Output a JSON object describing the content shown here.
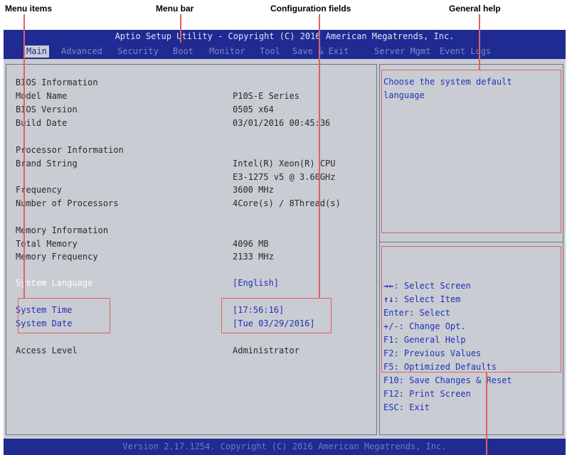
{
  "callouts": {
    "menu_items": "Menu items",
    "menu_bar": "Menu bar",
    "configuration_fields": "Configuration fields",
    "general_help": "General help"
  },
  "title": "Aptio Setup Utility - Copyright (C) 2016 American Megatrends, Inc.",
  "menu": {
    "items": [
      "Main",
      "Advanced",
      "Security",
      "Boot",
      "Monitor",
      "Tool",
      "Save & Exit",
      "Server Mgmt",
      "Event Logs"
    ],
    "active": "Main"
  },
  "info": {
    "bios_info": "BIOS Information",
    "model_name_label": "Model Name",
    "model_name_value": "P10S-E Series",
    "bios_version_label": "BIOS Version",
    "bios_version_value": "0505 x64",
    "build_date_label": "Build Date",
    "build_date_value": "03/01/2016 00:45:36",
    "processor_info": "Processor Information",
    "brand_string_label": "Brand String",
    "brand_string_value_1": "Intel(R) Xeon(R) CPU",
    "brand_string_value_2": "E3-1275 v5 @ 3.60GHz",
    "frequency_label": "Frequency",
    "frequency_value": "3600 MHz",
    "num_processors_label": "Number of Processors",
    "num_processors_value": "4Core(s) / 8Thread(s)",
    "memory_info": "Memory Information",
    "total_memory_label": "Total Memory",
    "total_memory_value": "4096 MB",
    "memory_freq_label": "Memory Frequency",
    "memory_freq_value": "2133 MHz"
  },
  "settings": {
    "system_language_label": "System Language",
    "system_language_value": "[English]",
    "system_time_label": "System Time",
    "system_time_value": "[17:56:16]",
    "system_date_label": "System Date",
    "system_date_value": "[Tue 03/29/2016]",
    "access_level_label": "Access Level",
    "access_level_value": "Administrator"
  },
  "help": {
    "description_1": "Choose the system default",
    "description_2": "language",
    "keys": [
      {
        "key": "→←",
        "text": ": Select Screen"
      },
      {
        "key": "↑↓",
        "text": ": Select Item"
      },
      {
        "key": "",
        "text": "Enter: Select"
      },
      {
        "key": "",
        "text": "+/-: Change Opt."
      },
      {
        "key": "",
        "text": "F1: General Help"
      },
      {
        "key": "",
        "text": "F2: Previous Values"
      },
      {
        "key": "",
        "text": "F5: Optimized Defaults"
      },
      {
        "key": "",
        "text": "F10: Save Changes & Reset"
      },
      {
        "key": "",
        "text": "F12: Print Screen"
      },
      {
        "key": "",
        "text": "ESC: Exit"
      }
    ]
  },
  "footer": "Version 2.17.1254. Copyright (C) 2016 American Megatrends, Inc.",
  "colors": {
    "bios_blue": "#1f2a92",
    "screen_gray": "#c9ccd3",
    "highlight_blue": "#1f33b4",
    "callout_red": "#e06060"
  }
}
